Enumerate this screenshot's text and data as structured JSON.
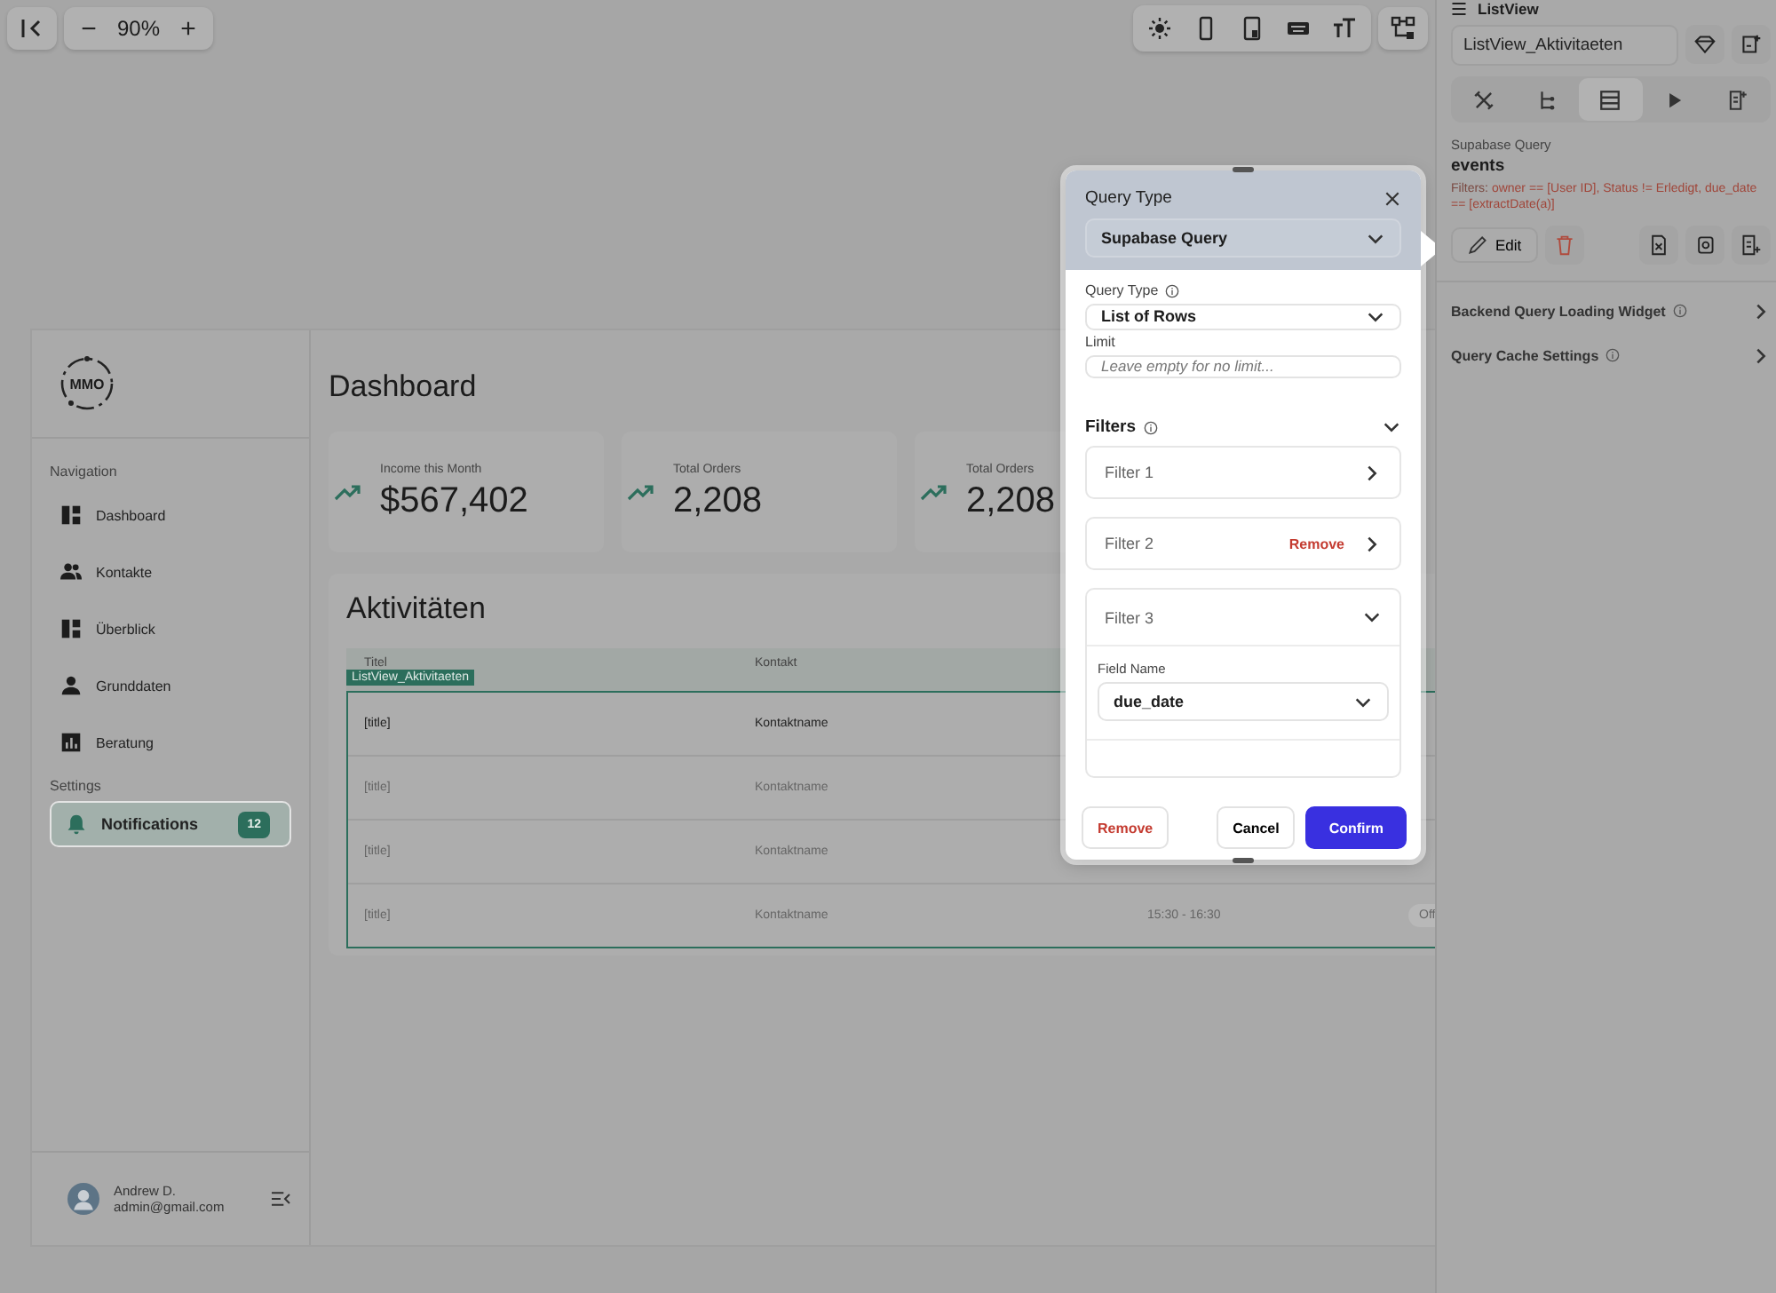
{
  "toolbar": {
    "zoom": "90%",
    "zoom_out": "−",
    "zoom_in": "+"
  },
  "app": {
    "logo": "MMO",
    "nav_heading": "Navigation",
    "nav": [
      {
        "label": "Dashboard",
        "kind": "dashboard",
        "selected": false
      },
      {
        "label": "Kontakte",
        "kind": "people",
        "selected": false
      },
      {
        "label": "Überblick",
        "kind": "dashboard",
        "selected": false
      },
      {
        "label": "Grunddaten",
        "kind": "person",
        "selected": false
      },
      {
        "label": "Beratung",
        "kind": "chart",
        "selected": false
      }
    ],
    "settings_heading": "Settings",
    "settings": [
      {
        "label": "Notifications",
        "kind": "bell",
        "selected": true,
        "badge": "12"
      }
    ],
    "user": {
      "name": "Andrew D.",
      "email": "admin@gmail.com"
    },
    "title": "Dashboard",
    "metrics": [
      {
        "label": "Income this Month",
        "value": "$567,402"
      },
      {
        "label": "Total Orders",
        "value": "2,208"
      },
      {
        "label": "Total Orders",
        "value": "2,208"
      }
    ],
    "activities": {
      "title": "Aktivitäten",
      "columns": [
        "Titel",
        "Kontakt"
      ],
      "list_tag": "ListView_Aktivitaeten",
      "rows": [
        {
          "title": "[title]",
          "contact": "Kontaktname",
          "emphasis": true
        },
        {
          "title": "[title]",
          "contact": "Kontaktname",
          "emphasis": false
        },
        {
          "title": "[title]",
          "contact": "Kontaktname",
          "emphasis": false
        },
        {
          "title": "[title]",
          "contact": "Kontaktname",
          "emphasis": false,
          "time": "15:30 - 16:30",
          "status": "Off"
        }
      ]
    }
  },
  "dialog": {
    "header_label": "Query Type",
    "source": "Supabase Query",
    "type_label": "Query Type",
    "type": "List of Rows",
    "limit_label": "Limit",
    "limit_placeholder": "Leave empty for no limit...",
    "filters_label": "Filters",
    "filters_expanded": true,
    "filters": [
      {
        "name": "Filter 1",
        "expanded": false
      },
      {
        "name": "Filter 2",
        "expanded": false,
        "remove": "Remove"
      },
      {
        "name": "Filter 3",
        "expanded": true,
        "field_label": "Field Name",
        "field": "due_date"
      }
    ],
    "remove": "Remove",
    "cancel": "Cancel",
    "confirm": "Confirm"
  },
  "panel": {
    "title": "ListView",
    "name": "ListView_Aktivitaeten",
    "tabs": [
      {
        "kind": "tools",
        "selected": false
      },
      {
        "kind": "tree",
        "selected": false
      },
      {
        "kind": "table",
        "selected": true
      },
      {
        "kind": "play",
        "selected": false
      },
      {
        "kind": "doc",
        "selected": false
      }
    ],
    "query_kind": "Supabase Query",
    "table": "events",
    "filters_label": "Filters:",
    "filters": "owner == [User ID], Status != Erledigt, due_date == [extractDate(a)]",
    "edit": "Edit",
    "sections": [
      {
        "label": "Backend Query Loading Widget"
      },
      {
        "label": "Query Cache Settings"
      }
    ]
  }
}
